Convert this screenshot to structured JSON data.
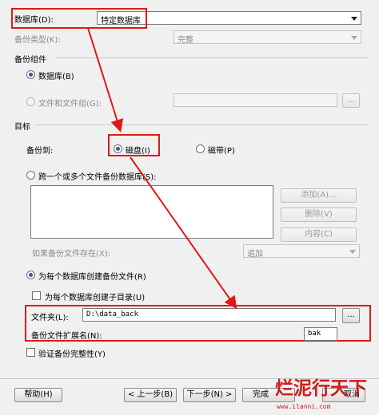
{
  "database": {
    "label": "数据库(D):",
    "value": "特定数据库"
  },
  "backup_type": {
    "label": "备份类型(K):",
    "value": "完整"
  },
  "backup_component": {
    "heading": "备份组件",
    "database_option": "数据库(B)",
    "files_option": "文件和文件组(G):"
  },
  "target": {
    "heading": "目标",
    "backup_to_label": "备份到:",
    "disk_option": "磁盘(I)",
    "tape_option": "磁带(P)",
    "span_files_option": "跨一个或多个文件备份数据库(S):",
    "add_button": "添加(A)...",
    "remove_button": "删除(V)",
    "contents_button": "内容(C)",
    "if_exists_label": "如果备份文件存在(X):",
    "if_exists_value": "追加",
    "per_db_option": "为每个数据库创建备份文件(R)",
    "subdir_option": "为每个数据库创建子目录(U)",
    "folder_label": "文件夹(L):",
    "folder_value": "D:\\data_back",
    "browse_button": "...",
    "extension_label": "备份文件扩展名(N):",
    "extension_value": "bak"
  },
  "verify_option": "验证备份完整性(Y)",
  "buttons": {
    "help": "帮助(H)",
    "back": "< 上一步(B)",
    "next": "下一步(N) >",
    "finish": "完成",
    "cancel": "取消"
  },
  "watermark": {
    "text": "烂泥行天下",
    "url": "www.ilanni.com"
  },
  "colors": {
    "annotation_red": "#e01818",
    "radio_blue": "#2b5db6"
  }
}
